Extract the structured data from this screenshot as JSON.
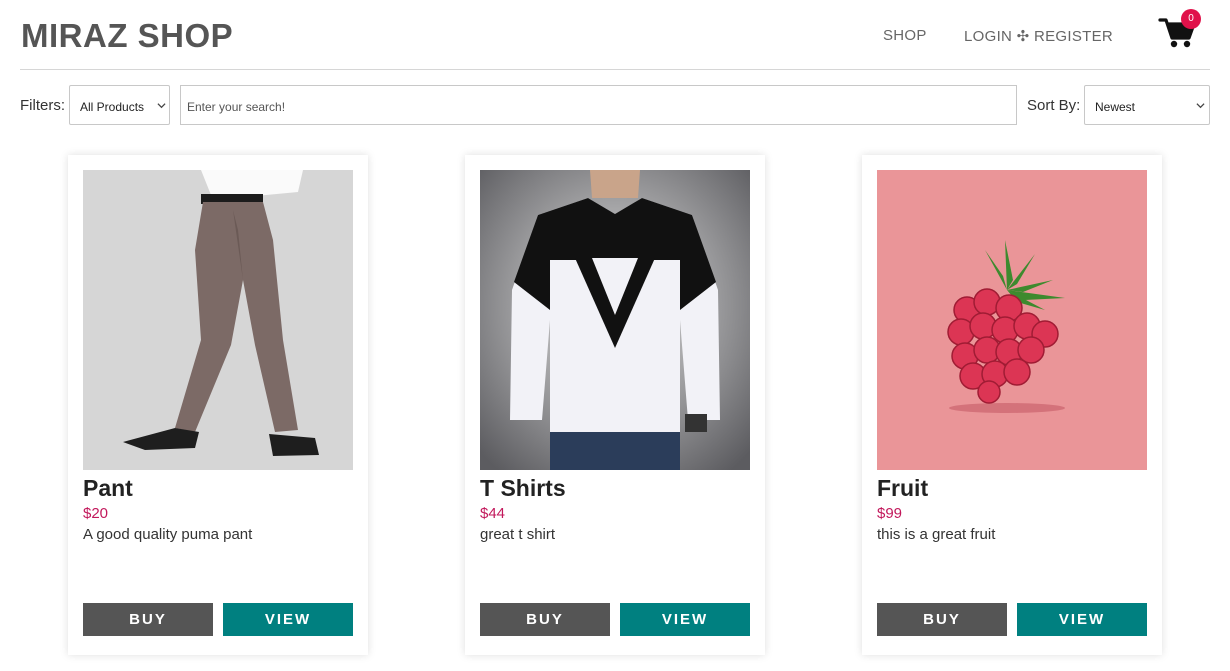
{
  "header": {
    "brand": "MIRAZ SHOP",
    "nav_shop": "SHOP",
    "nav_login_register": "LOGIN ✣ REGISTER",
    "cart_count": "0"
  },
  "filters": {
    "label": "Filters:",
    "category_selected": "All Products",
    "search_placeholder": "Enter your search!",
    "sort_label": "Sort By:",
    "sort_selected": "Newest"
  },
  "products": [
    {
      "title": "Pant",
      "price": "$20",
      "description": "A good quality puma pant",
      "buy_label": "BUY",
      "view_label": "VIEW"
    },
    {
      "title": "T Shirts",
      "price": "$44",
      "description": "great t shirt",
      "buy_label": "BUY",
      "view_label": "VIEW"
    },
    {
      "title": "Fruit",
      "price": "$99",
      "description": "this is a great fruit",
      "buy_label": "BUY",
      "view_label": "VIEW"
    }
  ],
  "colors": {
    "brand_text": "#555555",
    "buy_button": "#555555",
    "view_button": "#008080",
    "price": "#c2185b",
    "cart_badge": "#e0114a"
  },
  "icons": {
    "cart": "shopping-cart-icon",
    "dropdown": "chevron-down-icon"
  }
}
